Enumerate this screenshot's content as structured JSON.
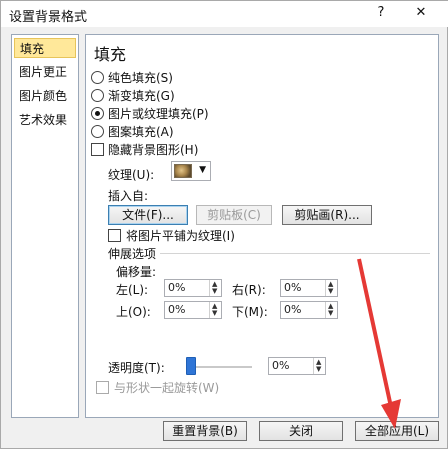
{
  "window": {
    "title": "设置背景格式",
    "help_icon": "?",
    "close_icon": "✕"
  },
  "sidebar": {
    "items": [
      {
        "label": "填充",
        "selected": true
      },
      {
        "label": "图片更正"
      },
      {
        "label": "图片颜色"
      },
      {
        "label": "艺术效果"
      }
    ]
  },
  "panel": {
    "heading": "填充",
    "fill_options": [
      {
        "label": "纯色填充(S)",
        "checked": false
      },
      {
        "label": "渐变填充(G)",
        "checked": false
      },
      {
        "label": "图片或纹理填充(P)",
        "checked": true
      },
      {
        "label": "图案填充(A)",
        "checked": false
      }
    ],
    "hide_bg_graphics": "隐藏背景图形(H)",
    "texture_label": "纹理(U):",
    "insert_from": "插入自:",
    "file_button": "文件(F)...",
    "clipboard_button": "剪贴板(C)",
    "clipart_button": "剪贴画(R)...",
    "tile_as_texture": "将图片平铺为纹理(I)",
    "stretch_options": "伸展选项",
    "offset_label": "偏移量:",
    "offsets": {
      "left": {
        "label": "左(L):",
        "value": "0%"
      },
      "right": {
        "label": "右(R):",
        "value": "0%"
      },
      "top": {
        "label": "上(O):",
        "value": "0%"
      },
      "bottom": {
        "label": "下(M):",
        "value": "0%"
      }
    },
    "transparency_label": "透明度(T):",
    "transparency_value": "0%",
    "rotate_with_shape": "与形状一起旋转(W)"
  },
  "footer": {
    "reset_button": "重置背景(B)",
    "close_button": "关闭",
    "apply_all_button": "全部应用(L)"
  },
  "colors": {
    "accent": "#2f75d6",
    "annotation_arrow": "#e53935",
    "selection": "#ffe89a"
  }
}
